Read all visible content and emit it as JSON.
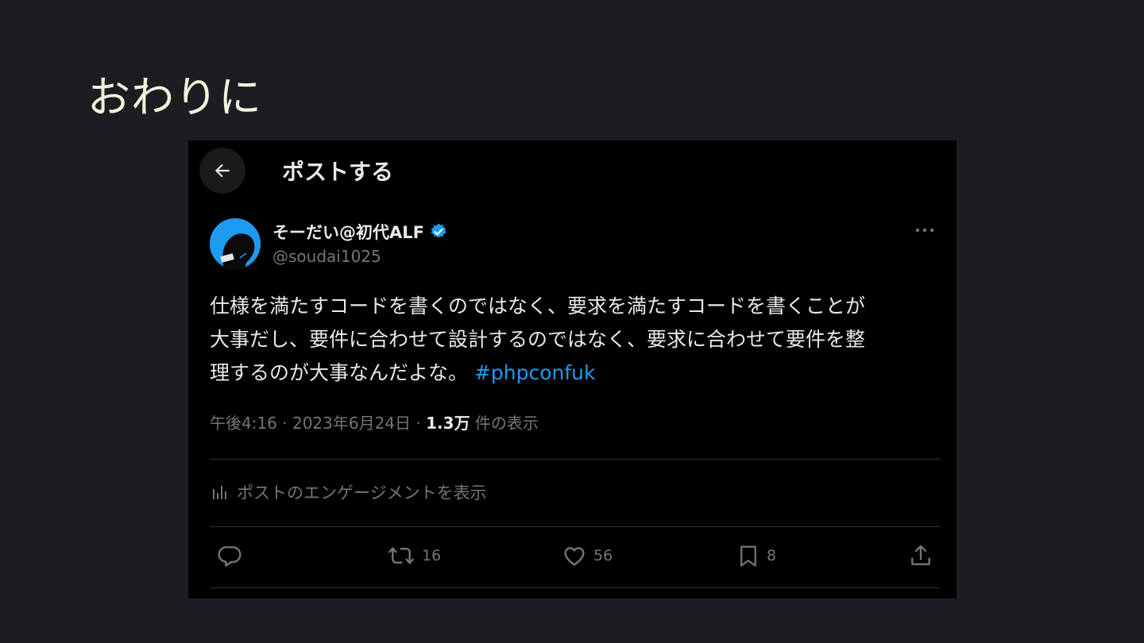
{
  "slide": {
    "title": "おわりに"
  },
  "post": {
    "header_title": "ポストする",
    "author": {
      "display_name": "そーだい@初代ALF",
      "handle": "@soudai1025"
    },
    "text_lines": [
      "仕様を満たすコードを書くのではなく、要求を満たすコードを書くことが",
      "大事だし、要件に合わせて設計するのではなく、要求に合わせて要件を整",
      "理するのが大事なんだよな。"
    ],
    "hashtag": "#phpconfuk",
    "meta": {
      "time_date": "午後4:16 · 2023年6月24日 · ",
      "views": "1.3万",
      "views_label": " 件の表示"
    },
    "engagement_label": "ポストのエンゲージメントを表示",
    "actions": {
      "retweets": "16",
      "likes": "56",
      "bookmarks": "8"
    }
  },
  "colors": {
    "background": "#1c1d20",
    "panel": "#000000",
    "accent": "#1d9bf0",
    "text_primary": "#e7e9ea",
    "text_secondary": "#71767b",
    "title": "#f3f1dc"
  },
  "icons": {
    "back": "arrow-left-icon",
    "verified": "verified-badge-icon",
    "more": "more-dots-icon",
    "engagement": "bar-chart-icon",
    "reply": "reply-icon",
    "retweet": "retweet-icon",
    "like": "heart-icon",
    "bookmark": "bookmark-icon",
    "share": "share-icon"
  }
}
